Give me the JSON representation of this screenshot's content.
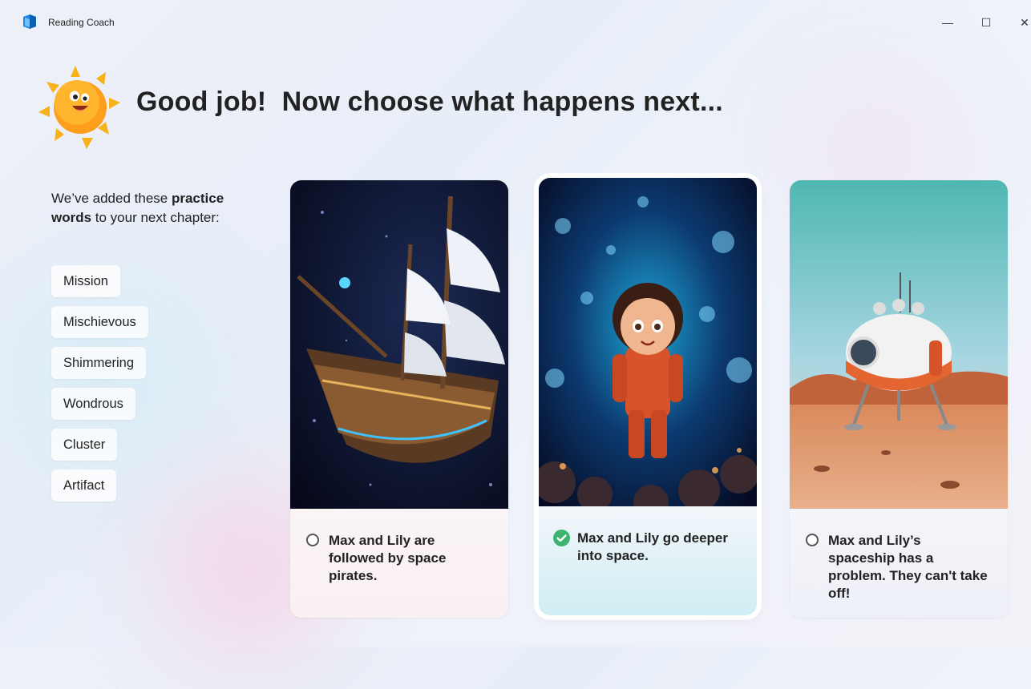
{
  "app": {
    "title": "Reading Coach"
  },
  "window_controls": {
    "minimize": "—",
    "maximize": "☐",
    "close": "✕"
  },
  "heading": "Good job!  Now choose what happens next...",
  "practice": {
    "intro_prefix": "We’ve added these ",
    "intro_bold": "practice words",
    "intro_suffix": " to your next chapter:",
    "words": [
      "Mission",
      "Mischievous",
      "Shimmering",
      "Wondrous",
      "Cluster",
      "Artifact"
    ]
  },
  "choices": [
    {
      "label": "Max and Lily are followed by space pirates.",
      "selected": false,
      "image": "pirate-ship-image"
    },
    {
      "label": "Max and Lily go deeper into space.",
      "selected": true,
      "image": "astronaut-girl-image"
    },
    {
      "label": "Max and Lily’s spaceship has a problem. They can't take off!",
      "selected": false,
      "image": "landed-spaceship-image"
    }
  ],
  "colors": {
    "check_green": "#3cb371",
    "accent_blue": "#2a7bd6"
  }
}
